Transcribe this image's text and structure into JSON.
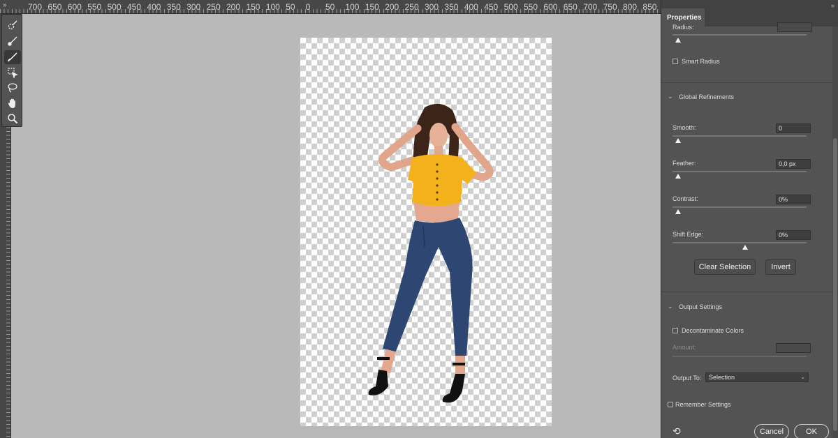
{
  "ruler": {
    "labels": [
      "700",
      "650",
      "600",
      "550",
      "500",
      "450",
      "400",
      "350",
      "300",
      "250",
      "200",
      "150",
      "100",
      "50",
      "0",
      "50",
      "100",
      "150",
      "200",
      "250",
      "300",
      "350",
      "400",
      "450",
      "500",
      "550",
      "600",
      "650",
      "700",
      "750",
      "800",
      "850",
      "90"
    ]
  },
  "toolbar": {
    "tools": [
      {
        "icon": "quick-selection-icon",
        "active": false
      },
      {
        "icon": "refine-edge-brush-icon",
        "active": false
      },
      {
        "icon": "brush-icon",
        "active": true
      },
      {
        "icon": "object-selection-icon",
        "active": false
      },
      {
        "icon": "lasso-icon",
        "active": false
      },
      {
        "icon": "hand-icon",
        "active": false
      },
      {
        "icon": "zoom-icon",
        "active": false
      }
    ]
  },
  "panel": {
    "tab_label": "Properties",
    "radius_label": "Radius:",
    "radius_level": 0,
    "smart_radius_label": "Smart Radius",
    "smart_radius_checked": false,
    "global_refinements_label": "Global Refinements",
    "smooth": {
      "label": "Smooth:",
      "value": "0",
      "level": 0
    },
    "feather": {
      "label": "Feather:",
      "value": "0,0 px",
      "level": 0
    },
    "contrast": {
      "label": "Contrast:",
      "value": "0%",
      "level": 0
    },
    "shift_edge": {
      "label": "Shift Edge:",
      "value": "0%",
      "level": 0.5
    },
    "clear_selection_label": "Clear Selection",
    "invert_label": "Invert",
    "output_settings_label": "Output Settings",
    "decontaminate_label": "Decontaminate Colors",
    "decontaminate_checked": false,
    "amount_label": "Amount:",
    "output_to_label": "Output To:",
    "output_to_value": "Selection",
    "remember_settings_label": "Remember Settings",
    "remember_checked": false,
    "cancel_label": "Cancel",
    "ok_label": "OK"
  },
  "colors": {
    "panel_bg": "#535353",
    "canvas_bg": "#b9b9b9",
    "shirt": "#f3b21c",
    "jeans": "#2d4672"
  }
}
